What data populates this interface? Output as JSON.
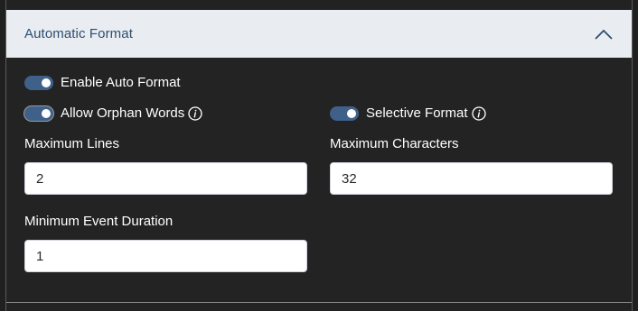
{
  "panel": {
    "title": "Automatic Format",
    "toggles": {
      "enable_auto_format": {
        "label": "Enable Auto Format",
        "on": true
      },
      "allow_orphan_words": {
        "label": "Allow Orphan Words",
        "on": true
      },
      "selective_format": {
        "label": "Selective Format",
        "on": true
      }
    },
    "fields": {
      "maximum_lines": {
        "label": "Maximum Lines",
        "value": "2"
      },
      "maximum_characters": {
        "label": "Maximum Characters",
        "value": "32"
      },
      "minimum_event_duration": {
        "label": "Minimum Event Duration",
        "value": "1"
      }
    }
  },
  "colors": {
    "header_bg": "#e9edf2",
    "header_text": "#2e4d6e",
    "panel_bg": "#232323",
    "toggle_on": "#3f6189"
  },
  "icons": [
    "chevron-up-icon",
    "info-icon"
  ]
}
